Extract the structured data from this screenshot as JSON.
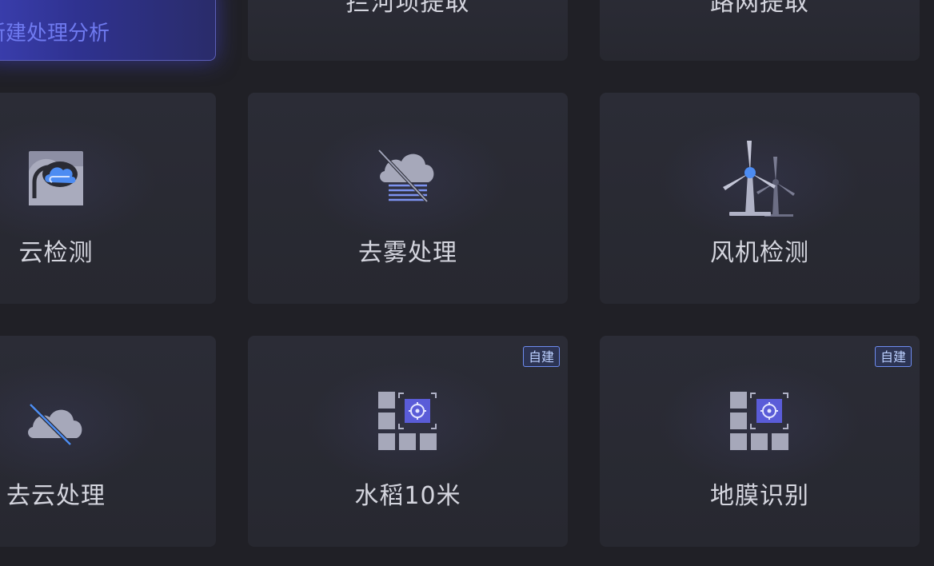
{
  "new_task_button": {
    "label": "新建处理分析"
  },
  "cards": {
    "dam": {
      "label": "拦河坝提取"
    },
    "road": {
      "label": "路网提取"
    },
    "cloud_detect": {
      "label": "云检测"
    },
    "dehaze": {
      "label": "去雾处理"
    },
    "wind_turbine": {
      "label": "风机检测"
    },
    "cloud_remove": {
      "label": "去云处理"
    },
    "rice": {
      "label": "水稻10米",
      "badge": "自建"
    },
    "film": {
      "label": "地膜识别",
      "badge": "自建"
    }
  },
  "colors": {
    "background": "#202026",
    "card": "#2a2b34",
    "label": "#d4d5de",
    "accent": "#5a5cd8",
    "badge_border": "#6e8cf0"
  },
  "icons": {
    "cloud_detect": "cloud-detect-icon",
    "dehaze": "dehaze-icon",
    "wind_turbine": "wind-turbine-icon",
    "cloud_remove": "cloud-remove-icon",
    "rice": "grid-target-icon",
    "film": "grid-target-icon"
  }
}
